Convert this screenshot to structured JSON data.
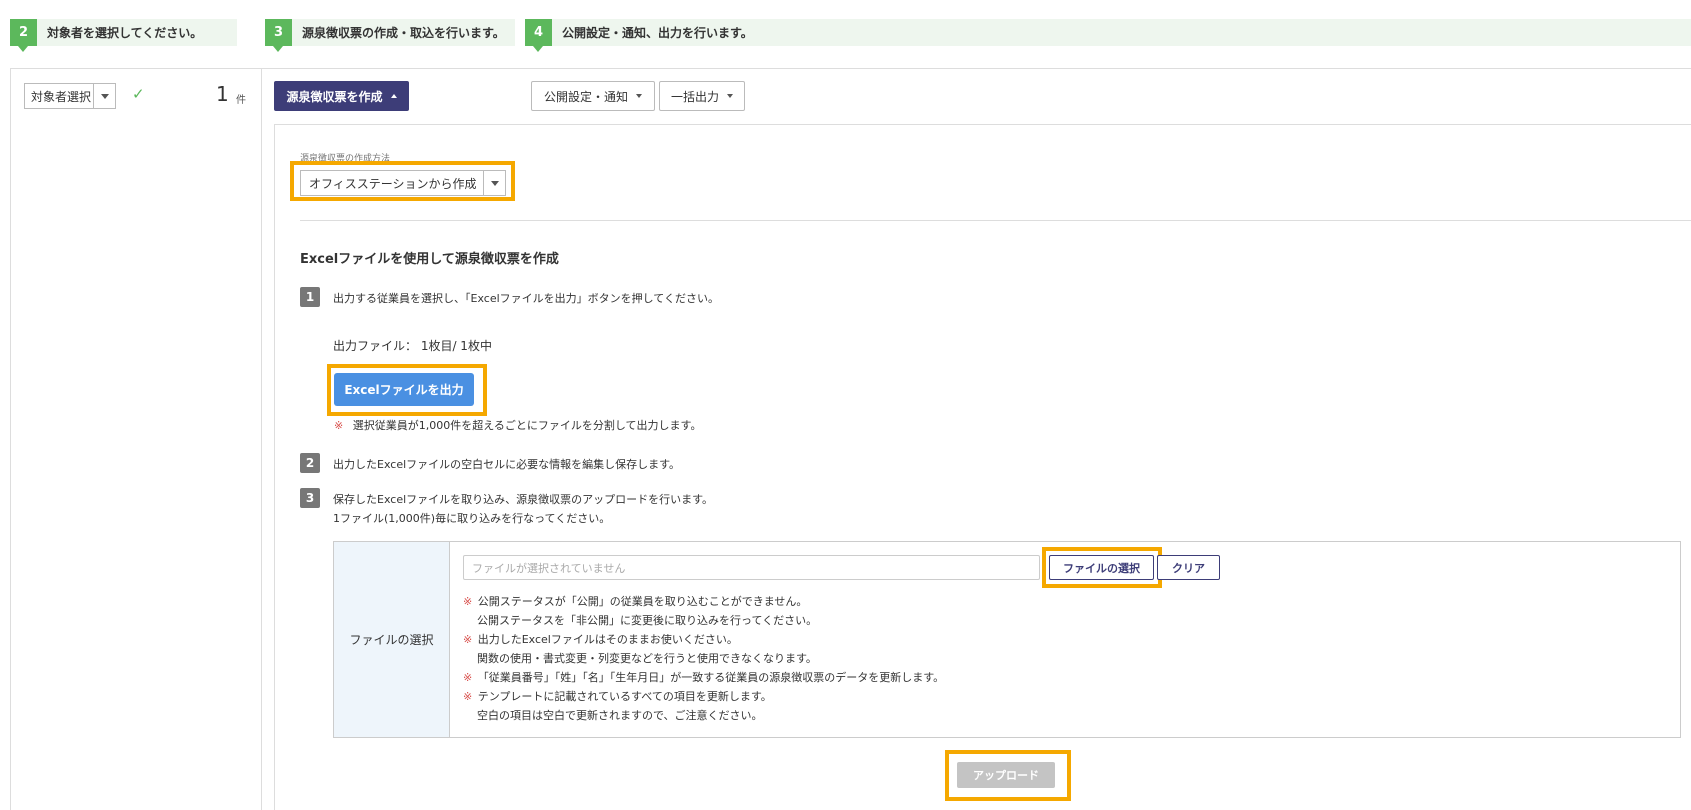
{
  "steps": [
    {
      "num": "2",
      "label": "対象者を選択してください。"
    },
    {
      "num": "3",
      "label": "源泉徴収票の作成・取込を行います。"
    },
    {
      "num": "4",
      "label": "公開設定・通知、出力を行います。"
    }
  ],
  "left": {
    "selector_label": "対象者選択",
    "count": "1",
    "count_unit": "件"
  },
  "toolbar": {
    "create_label": "源泉徴収票を作成",
    "publish_label": "公開設定・通知",
    "bulk_output_label": "一括出力"
  },
  "method": {
    "label": "源泉徴収票の作成方法",
    "selected": "オフィスステーションから作成"
  },
  "section_title": "Excelファイルを使用して源泉徴収票を作成",
  "instructions": [
    {
      "num": "1",
      "text": "出力する従業員を選択し、「Excelファイルを出力」ボタンを押してください。"
    },
    {
      "num": "2",
      "text": "出力したExcelファイルの空白セルに必要な情報を編集し保存します。"
    },
    {
      "num": "3",
      "text": "保存したExcelファイルを取り込み、源泉徴収票のアップロードを行います。",
      "text2": "1ファイル(1,000件)毎に取り込みを行なってください。"
    }
  ],
  "output_file": {
    "text": "出力ファイル： 1枚目/ 1枚中",
    "button_label": "Excelファイルを出力",
    "note_mark": "※",
    "note": "選択従業員が1,000件を超えるごとにファイルを分割して出力します。"
  },
  "file_select": {
    "header": "ファイルの選択",
    "placeholder": "ファイルが選択されていません",
    "choose_label": "ファイルの選択",
    "clear_label": "クリア",
    "mark": "※",
    "notes": [
      {
        "mark": true,
        "text": "公開ステータスが「公開」の従業員を取り込むことができません。"
      },
      {
        "mark": false,
        "text": "公開ステータスを「非公開」に変更後に取り込みを行ってください。"
      },
      {
        "mark": true,
        "text": "出力したExcelファイルはそのままお使いください。"
      },
      {
        "mark": false,
        "text": "関数の使用・書式変更・列変更などを行うと使用できなくなります。"
      },
      {
        "mark": true,
        "text": "「従業員番号」「姓」「名」「生年月日」が一致する従業員の源泉徴収票のデータを更新します。"
      },
      {
        "mark": true,
        "text": "テンプレートに記載されているすべての項目を更新します。"
      },
      {
        "mark": false,
        "text": "空白の項目は空白で更新されますので、ご注意ください。"
      }
    ]
  },
  "upload_label": "アップロード",
  "colors": {
    "step_green": "#5cb85c",
    "primary_navy": "#3d3d78",
    "excel_blue": "#4a90e2",
    "highlight": "#f5a800",
    "note_red": "#d9534f"
  }
}
